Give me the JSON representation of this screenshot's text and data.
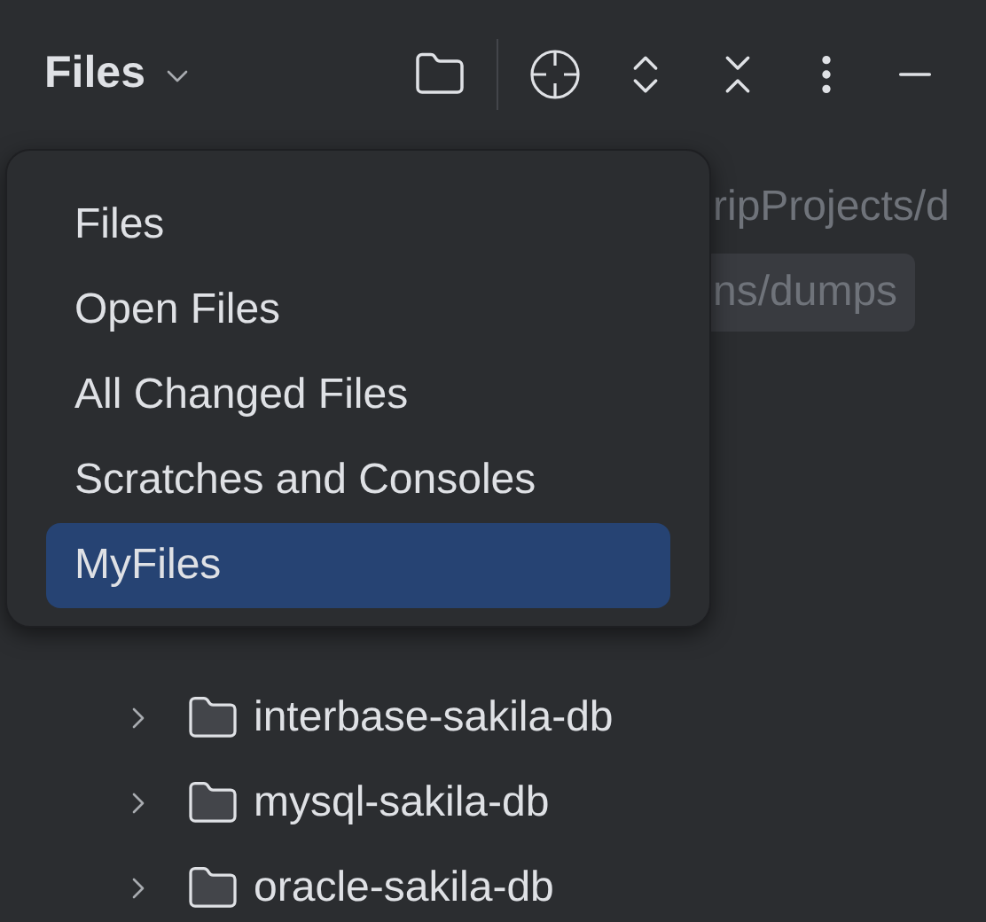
{
  "header": {
    "title": "Files"
  },
  "tree": {
    "path_rows": [
      {
        "text": "ripProjects/d",
        "selected": false
      },
      {
        "text": "ns/dumps",
        "selected": true
      }
    ],
    "items": [
      {
        "name": "interbase-sakila-db",
        "expanded": false
      },
      {
        "name": "mysql-sakila-db",
        "expanded": false
      },
      {
        "name": "oracle-sakila-db",
        "expanded": false
      }
    ]
  },
  "menu": {
    "items": [
      {
        "label": "Files",
        "selected": false
      },
      {
        "label": "Open Files",
        "selected": false
      },
      {
        "label": "All Changed Files",
        "selected": false
      },
      {
        "label": "Scratches and Consoles",
        "selected": false
      },
      {
        "label": "MyFiles",
        "selected": true
      }
    ]
  }
}
